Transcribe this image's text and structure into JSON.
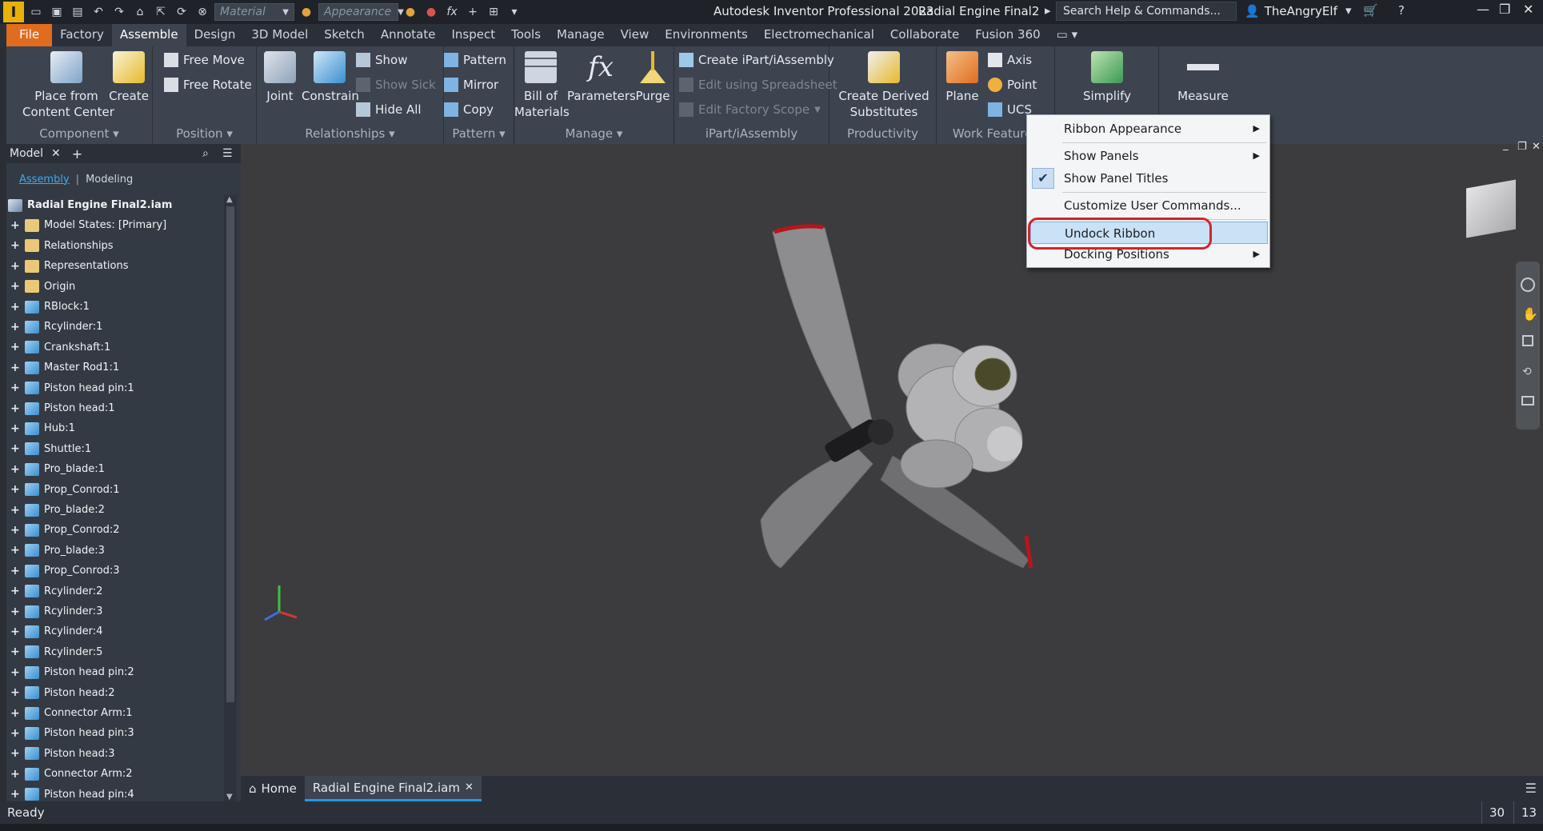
{
  "titlebar": {
    "app_letter": "I",
    "material": "Material",
    "appearance": "Appearance",
    "app_title": "Autodesk Inventor Professional 2023",
    "doc_title": "Radial Engine Final2",
    "search": "Search Help & Commands...",
    "user": "TheAngryElf"
  },
  "tabs": [
    "File",
    "Factory",
    "Assemble",
    "Design",
    "3D Model",
    "Sketch",
    "Annotate",
    "Inspect",
    "Tools",
    "Manage",
    "View",
    "Environments",
    "Electromechanical",
    "Collaborate",
    "Fusion 360"
  ],
  "ribbon": {
    "component": {
      "title": "Component",
      "place": "Place from",
      "place2": "Content Center",
      "create": "Create"
    },
    "position": {
      "title": "Position",
      "free_move": "Free Move",
      "free_rotate": "Free Rotate"
    },
    "relationships": {
      "title": "Relationships",
      "joint": "Joint",
      "constrain": "Constrain",
      "show": "Show",
      "show_sick": "Show Sick",
      "hide_all": "Hide All"
    },
    "pattern": {
      "title": "Pattern",
      "pattern": "Pattern",
      "mirror": "Mirror",
      "copy": "Copy"
    },
    "manage": {
      "title": "Manage",
      "bom": "Bill of",
      "bom2": "Materials",
      "parameters": "Parameters",
      "purge": "Purge"
    },
    "ipart": {
      "title": "iPart/iAssembly",
      "create": "Create iPart/iAssembly",
      "edit_sheet": "Edit using Spreadsheet",
      "edit_scope": "Edit Factory Scope"
    },
    "productivity": {
      "title": "Productivity",
      "derived": "Create Derived",
      "derived2": "Substitutes"
    },
    "work": {
      "title": "Work Features",
      "plane": "Plane",
      "axis": "Axis",
      "point": "Point",
      "ucs": "UCS"
    },
    "simplify": "Simplify",
    "measure": "Measure"
  },
  "context_menu": {
    "ribbon_appearance": "Ribbon Appearance",
    "show_panels": "Show Panels",
    "show_panel_titles": "Show Panel Titles",
    "customize": "Customize User Commands...",
    "undock": "Undock Ribbon",
    "docking": "Docking Positions"
  },
  "browser": {
    "title": "Model",
    "tab_assembly": "Assembly",
    "tab_modeling": "Modeling",
    "root": "Radial Engine Final2.iam",
    "nodes": [
      {
        "label": "Model States: [Primary]",
        "icon": "folder"
      },
      {
        "label": "Relationships",
        "icon": "folder"
      },
      {
        "label": "Representations",
        "icon": "folder"
      },
      {
        "label": "Origin",
        "icon": "folder"
      },
      {
        "label": "RBlock:1",
        "icon": "part"
      },
      {
        "label": "Rcylinder:1",
        "icon": "part"
      },
      {
        "label": "Crankshaft:1",
        "icon": "part"
      },
      {
        "label": "Master Rod1:1",
        "icon": "part"
      },
      {
        "label": "Piston head pin:1",
        "icon": "part"
      },
      {
        "label": "Piston head:1",
        "icon": "part"
      },
      {
        "label": "Hub:1",
        "icon": "part"
      },
      {
        "label": "Shuttle:1",
        "icon": "part"
      },
      {
        "label": "Pro_blade:1",
        "icon": "part"
      },
      {
        "label": "Prop_Conrod:1",
        "icon": "part"
      },
      {
        "label": "Pro_blade:2",
        "icon": "part"
      },
      {
        "label": "Prop_Conrod:2",
        "icon": "part"
      },
      {
        "label": "Pro_blade:3",
        "icon": "part"
      },
      {
        "label": "Prop_Conrod:3",
        "icon": "part"
      },
      {
        "label": "Rcylinder:2",
        "icon": "part"
      },
      {
        "label": "Rcylinder:3",
        "icon": "part"
      },
      {
        "label": "Rcylinder:4",
        "icon": "part"
      },
      {
        "label": "Rcylinder:5",
        "icon": "part"
      },
      {
        "label": "Piston head pin:2",
        "icon": "part"
      },
      {
        "label": "Piston head:2",
        "icon": "part"
      },
      {
        "label": "Connector Arm:1",
        "icon": "part"
      },
      {
        "label": "Piston head pin:3",
        "icon": "part"
      },
      {
        "label": "Piston head:3",
        "icon": "part"
      },
      {
        "label": "Connector Arm:2",
        "icon": "part"
      },
      {
        "label": "Piston head pin:4",
        "icon": "part"
      }
    ]
  },
  "doc_tabs": {
    "home": "Home",
    "active": "Radial Engine Final2.iam"
  },
  "status": {
    "text": "Ready",
    "count1": "30",
    "count2": "13"
  },
  "colors": {
    "accent": "#1e9be6",
    "file_tab": "#e06c1f",
    "highlight_ring": "#d6232b"
  }
}
